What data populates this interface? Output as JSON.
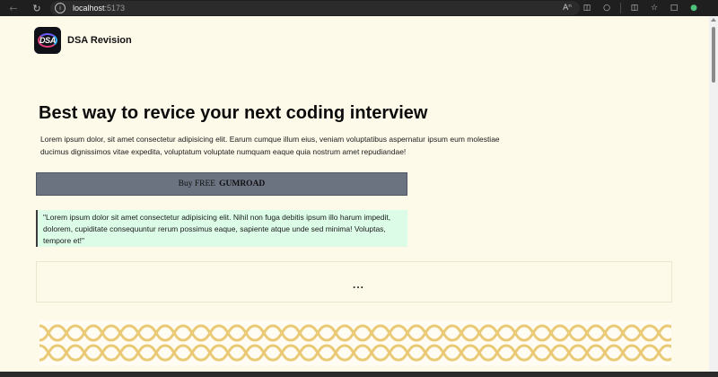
{
  "browser": {
    "url_host": "localhost",
    "url_port": ":5173",
    "icons": [
      "back-icon",
      "reload-icon",
      "info-icon",
      "read-aloud-icon",
      "split-screen-icon",
      "extensions-icon",
      "favorites-bar-icon",
      "favorites-icon",
      "collections-icon",
      "profile-icon"
    ]
  },
  "header": {
    "logo_text": "DSA",
    "brand_name": "DSA Revision"
  },
  "hero": {
    "title": "Best way to revice your next coding interview",
    "description": "Lorem ipsum dolor, sit amet consectetur adipisicing elit. Earum cumque illum eius, veniam voluptatibus aspernatur ipsum eum molestiae ducimus dignissimos vitae expedita, voluptatum voluptate numquam eaque quia nostrum amet repudiandae!",
    "buy_prefix": "Buy FREE",
    "buy_brand": "GUMROAD",
    "button_color": "#6b7280"
  },
  "quote": {
    "text": "\"Lorem ipsum dolor sit amet consectetur adipisicing elit. Nihil non fuga debitis ipsum illo harum impedit, dolorem, cupiditate consequuntur rerum possimus eaque, sapiente atque unde sed minima! Voluptas, tempore et!\"",
    "background": "#dcfce8"
  },
  "loading": {
    "dots": "..."
  },
  "colors": {
    "page_background": "#fefaea",
    "banner_gold": "#e8c56a"
  }
}
